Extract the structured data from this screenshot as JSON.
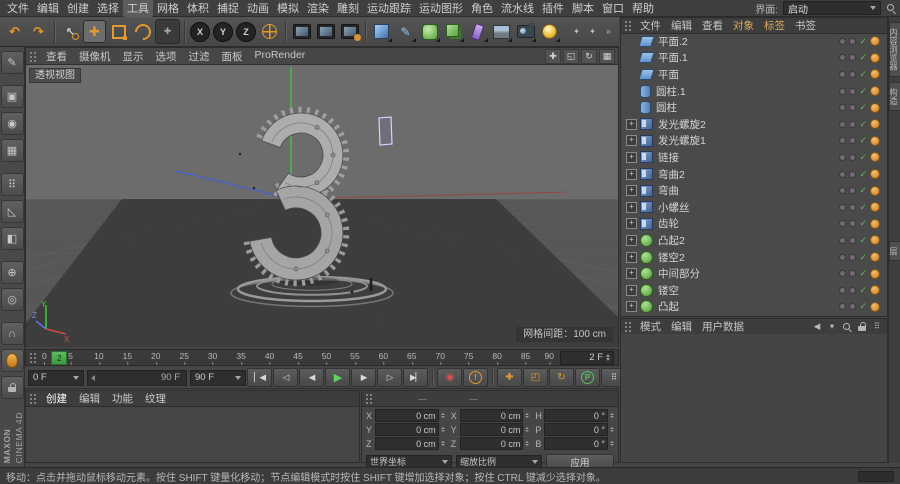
{
  "menubar": {
    "items": [
      "文件",
      "编辑",
      "创建",
      "选择",
      "工具",
      "网格",
      "体积",
      "捕捉",
      "动画",
      "模拟",
      "渲染",
      "雕刻",
      "运动跟踪",
      "运动图形",
      "角色",
      "流水线",
      "插件",
      "脚本",
      "窗口",
      "帮助"
    ],
    "active_item": "工具",
    "interface_label": "界面:",
    "interface_value": "启动"
  },
  "toolbar": {
    "icons": [
      {
        "name": "undo",
        "glyph": "↶"
      },
      {
        "name": "redo",
        "glyph": "↷"
      },
      {
        "name": "separator"
      },
      {
        "name": "live-selection",
        "glyph": "↖"
      },
      {
        "name": "move",
        "glyph": "✚",
        "active": true
      },
      {
        "name": "scale"
      },
      {
        "name": "rotate"
      },
      {
        "name": "last-tool",
        "glyph": "✚"
      },
      {
        "name": "separator"
      },
      {
        "name": "lock-x",
        "glyph": "X"
      },
      {
        "name": "lock-y",
        "glyph": "Y"
      },
      {
        "name": "lock-z",
        "glyph": "Z"
      },
      {
        "name": "coord-system"
      },
      {
        "name": "separator"
      },
      {
        "name": "render-view"
      },
      {
        "name": "render-picture-viewer"
      },
      {
        "name": "render-settings"
      },
      {
        "name": "separator"
      },
      {
        "name": "add-cube"
      },
      {
        "name": "spline-pen",
        "glyph": "✎"
      },
      {
        "name": "subdivision-surface"
      },
      {
        "name": "generators"
      },
      {
        "name": "deformers"
      },
      {
        "name": "floor"
      },
      {
        "name": "scene-camera"
      },
      {
        "name": "scene-light"
      },
      {
        "name": "spacer"
      },
      {
        "name": "default-light",
        "glyph": "✦",
        "small": true
      },
      {
        "name": "interactive-render",
        "glyph": "✦",
        "small": true
      },
      {
        "name": "toolbar-overflow",
        "glyph": "»",
        "small": true
      }
    ]
  },
  "left_toolbar": {
    "icons": [
      {
        "name": "make-editable",
        "glyph": "✎"
      },
      {
        "name": "model-mode",
        "glyph": "▣",
        "gap": true
      },
      {
        "name": "texture-mode",
        "glyph": "◉"
      },
      {
        "name": "workplane-mode",
        "glyph": "▦"
      },
      {
        "name": "points-mode",
        "glyph": "⠿",
        "gap": true
      },
      {
        "name": "edges-mode",
        "glyph": "◺"
      },
      {
        "name": "polygons-mode",
        "glyph": "◧"
      },
      {
        "name": "axis-mode",
        "glyph": "⊕",
        "gap": true
      },
      {
        "name": "viewport-solo",
        "glyph": "◎"
      },
      {
        "name": "snap",
        "glyph": "∩",
        "gap": true
      },
      {
        "name": "quantize",
        "type": "mouse"
      },
      {
        "name": "lock-workplane",
        "type": "lock"
      }
    ]
  },
  "viewport": {
    "menu": [
      "查看",
      "摄像机",
      "显示",
      "选项",
      "过滤",
      "面板",
      "ProRender"
    ],
    "corner_icons": [
      {
        "name": "pan-view",
        "glyph": "✚"
      },
      {
        "name": "zoom-view",
        "glyph": "◱"
      },
      {
        "name": "rotate-view",
        "glyph": "↻"
      },
      {
        "name": "toggle-views",
        "glyph": "▦"
      }
    ],
    "view_label": "透视视图",
    "grid_info": "网格间距：100 cm",
    "axis": {
      "x": "X",
      "y": "Y",
      "z": "Z"
    }
  },
  "timeline": {
    "ticks": [
      "0",
      "5",
      "10",
      "15",
      "20",
      "25",
      "30",
      "35",
      "40",
      "45",
      "50",
      "55",
      "60",
      "65",
      "70",
      "75",
      "80",
      "85",
      "90"
    ],
    "current": "2",
    "frame_field": "2 F"
  },
  "anim": {
    "start_frame": "0 F",
    "slider_value": "90 F",
    "end_frame": "90 F",
    "buttons": [
      {
        "name": "goto-start",
        "glyph": "▏◀"
      },
      {
        "name": "goto-prev-key",
        "glyph": "◁"
      },
      {
        "name": "prev-frame",
        "glyph": "◀"
      },
      {
        "name": "play",
        "glyph": "▶"
      },
      {
        "name": "next-frame",
        "glyph": "▶"
      },
      {
        "name": "goto-next-key",
        "glyph": "▷"
      },
      {
        "name": "goto-end",
        "glyph": "▶▏"
      },
      {
        "name": "sep"
      },
      {
        "name": "record",
        "glyph": "◉"
      },
      {
        "name": "autokey",
        "glyph": "!",
        "circle": "orange"
      },
      {
        "name": "sep"
      },
      {
        "name": "key-position",
        "glyph": "✚"
      },
      {
        "name": "key-scale",
        "glyph": "◰"
      },
      {
        "name": "key-rotation",
        "glyph": "↻"
      },
      {
        "name": "key-parameter",
        "glyph": "P",
        "circle": "green"
      },
      {
        "name": "key-pla",
        "glyph": "⠿"
      },
      {
        "name": "key-selection"
      }
    ]
  },
  "material_panel": {
    "tabs": [
      "创建",
      "编辑",
      "功能",
      "纹理"
    ],
    "active_tab": "创建"
  },
  "coords": {
    "headers": [
      "---",
      "---"
    ],
    "position": [
      {
        "label": "X",
        "value": "0 cm"
      },
      {
        "label": "Y",
        "value": "0 cm"
      },
      {
        "label": "Z",
        "value": "0 cm"
      }
    ],
    "size": [
      {
        "label": "X",
        "value": "0 cm"
      },
      {
        "label": "Y",
        "value": "0 cm"
      },
      {
        "label": "Z",
        "value": "0 cm"
      }
    ],
    "rotation": [
      {
        "label": "H",
        "value": "0 °"
      },
      {
        "label": "P",
        "value": "0 °"
      },
      {
        "label": "B",
        "value": "0 °"
      }
    ],
    "system": "世界坐标",
    "size_mode": "缩放比例",
    "apply_label": "应用"
  },
  "object_manager": {
    "menu": [
      "文件",
      "编辑",
      "查看",
      "对象",
      "标签",
      "书签"
    ],
    "accent_items": [
      "对象",
      "标签"
    ],
    "objects": [
      {
        "name": "平面.2",
        "icon": "plane",
        "expand": false
      },
      {
        "name": "平面.1",
        "icon": "plane",
        "expand": false
      },
      {
        "name": "平面",
        "icon": "plane",
        "expand": false
      },
      {
        "name": "圆柱.1",
        "icon": "cylinder",
        "expand": false
      },
      {
        "name": "圆柱",
        "icon": "cylinder",
        "expand": false
      },
      {
        "name": "发光螺旋2",
        "icon": "extrude",
        "expand": true
      },
      {
        "name": "发光螺旋1",
        "icon": "extrude",
        "expand": true
      },
      {
        "name": "链接",
        "icon": "extrude",
        "expand": true
      },
      {
        "name": "弯曲2",
        "icon": "extrude",
        "expand": true
      },
      {
        "name": "弯曲",
        "icon": "extrude",
        "expand": true
      },
      {
        "name": "小螺丝",
        "icon": "extrude",
        "expand": true
      },
      {
        "name": "齿轮",
        "icon": "extrude",
        "expand": true
      },
      {
        "name": "凸起2",
        "icon": "lathe",
        "expand": true
      },
      {
        "name": "镂空2",
        "icon": "lathe",
        "expand": true
      },
      {
        "name": "中间部分",
        "icon": "lathe",
        "expand": true
      },
      {
        "name": "镂空",
        "icon": "lathe",
        "expand": true
      },
      {
        "name": "凸起",
        "icon": "lathe",
        "expand": true
      }
    ]
  },
  "attribute_manager": {
    "menu": [
      "模式",
      "编辑",
      "用户数据"
    ],
    "icons": [
      {
        "name": "history-back",
        "glyph": "◀"
      },
      {
        "name": "history-menu",
        "glyph": "▾"
      },
      {
        "name": "search",
        "type": "mag"
      },
      {
        "name": "lock",
        "type": "lock"
      },
      {
        "name": "am-settings",
        "glyph": "⠿"
      }
    ]
  },
  "side_tabs": [
    "内容浏览器",
    "构造",
    "层"
  ],
  "statusbar": {
    "text": "移动：点击并拖动鼠标移动元素。按住 SHIFT 键量化移动；节点编辑模式时按住 SHIFT 键增加选择对象；按住 CTRL 键减少选择对象。"
  },
  "branding": {
    "line1": "MAXON",
    "line2": "CINEMA 4D"
  },
  "colors": {
    "accent_orange": "#e09a30",
    "check_green": "#55c050",
    "axis_green": "#3ecf3e",
    "axis_red": "#c04840",
    "axis_blue": "#4a5fd0",
    "selection_violet": "#d8d2ff"
  }
}
